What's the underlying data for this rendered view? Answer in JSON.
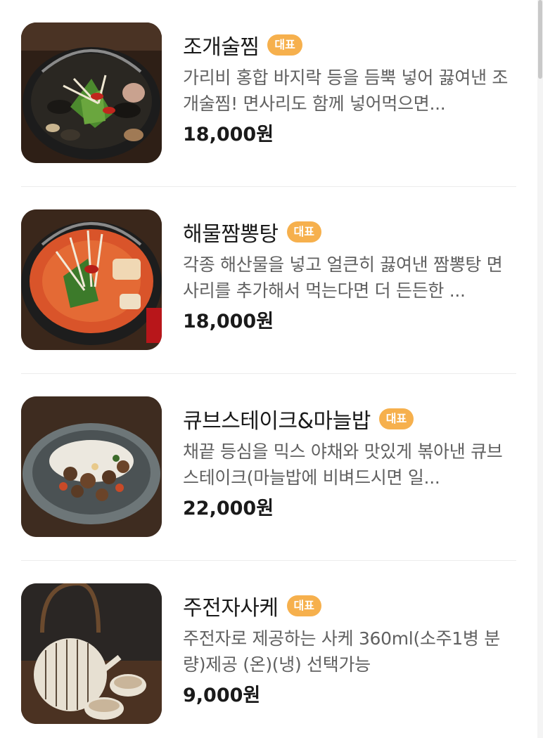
{
  "menu": {
    "items": [
      {
        "name": "조개술찜",
        "badge": "대표",
        "description": "가리비 홍합 바지락 등을 듬뿍 넣어 끓여낸 조개술찜! 면사리도 함께 넣어먹으면...",
        "price": "18,000원",
        "image": "steamed-clams-photo"
      },
      {
        "name": "해물짬뽕탕",
        "badge": "대표",
        "description": "각종 해산물을 넣고 얼큰히 끓여낸 짬뽕탕 면사리를 추가해서 먹는다면 더 든든한 ...",
        "price": "18,000원",
        "image": "seafood-jjamppong-photo"
      },
      {
        "name": "큐브스테이크&마늘밥",
        "badge": "대표",
        "description": "채끝 등심을 믹스 야채와 맛있게 볶아낸 큐브스테이크(마늘밥에 비벼드시면 일...",
        "price": "22,000원",
        "image": "cube-steak-garlic-rice-photo"
      },
      {
        "name": "주전자사케",
        "badge": "대표",
        "description": "주전자로 제공하는 사케 360ml(소주1병 분량)제공 (온)(냉) 선택가능",
        "price": "9,000원",
        "image": "sake-kettle-photo"
      }
    ]
  },
  "colors": {
    "badge": "#f6b04d",
    "title": "#1a1a1a",
    "description": "#606060",
    "divider": "#ececec"
  }
}
